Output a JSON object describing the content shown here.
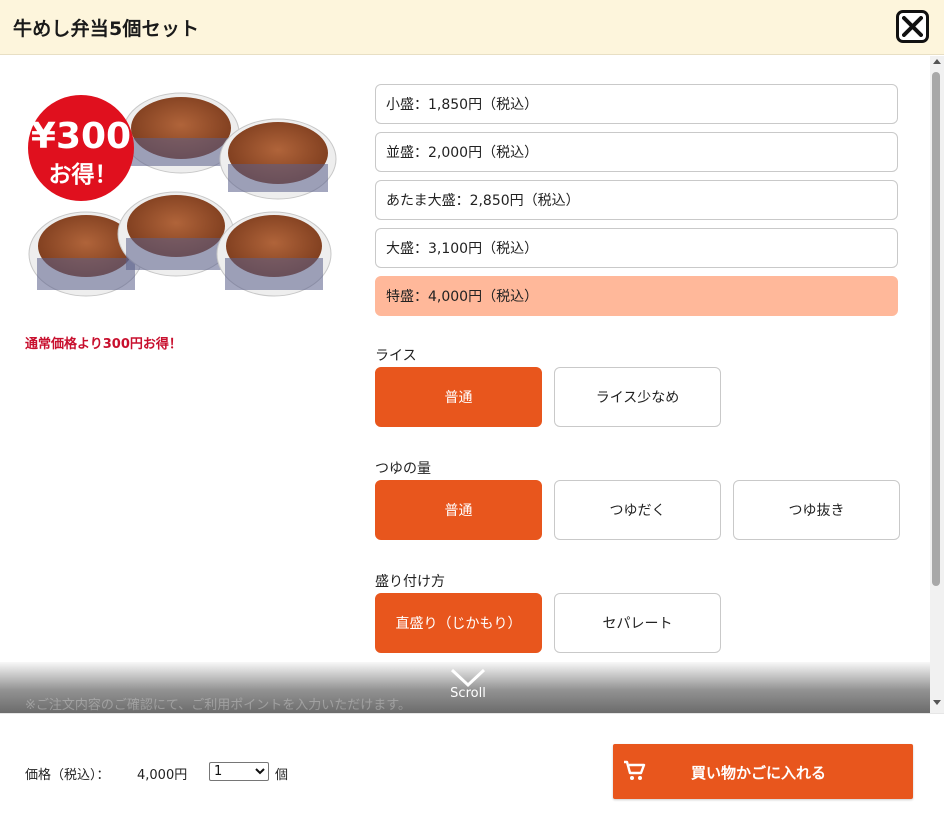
{
  "header": {
    "title": "牛めし弁当5個セット"
  },
  "product": {
    "badge_line1": "¥300",
    "badge_line2": "お得！",
    "discount_note": "通常価格より300円お得！"
  },
  "sizes": [
    {
      "label": "小盛：1,850円（税込）"
    },
    {
      "label": "並盛：2,000円（税込）"
    },
    {
      "label": "あたま大盛：2,850円（税込）"
    },
    {
      "label": "大盛：3,100円（税込）"
    },
    {
      "label": "特盛：4,000円（税込）"
    }
  ],
  "selected_size_index": 4,
  "rice": {
    "label": "ライス",
    "options": [
      "普通",
      "ライス少なめ"
    ]
  },
  "tsuyu": {
    "label": "つゆの量",
    "options": [
      "普通",
      "つゆだく",
      "つゆ抜き"
    ]
  },
  "serving": {
    "label": "盛り付け方",
    "options": [
      "直盛り（じかもり）",
      "セパレート"
    ]
  },
  "hidden_note": "※ご注文内容のご確認にて、ご利用ポイントを入力いただけます。",
  "scroll_hint": "Scroll",
  "footer": {
    "price_label": "価格（税込）：",
    "price_value": "4,000円",
    "quantity": "1",
    "unit": "個",
    "cart_label": "買い物かごに入れる"
  },
  "colors": {
    "accent": "#e8561d",
    "selected_size": "#ffb89a",
    "header_bg": "#fdf5dc",
    "badge_red": "#e0101e",
    "note_red": "#c8102e"
  }
}
